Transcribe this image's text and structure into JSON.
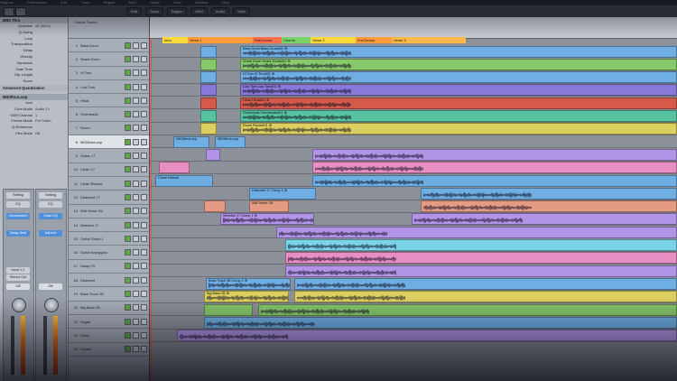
{
  "app": {
    "menu": [
      "Regions",
      "Preferences",
      "Edit",
      "Track",
      "Region",
      "MIDI",
      "Audio",
      "View",
      "Window",
      "Help"
    ],
    "toolbar_tabs": [
      "Edit",
      "Track",
      "Region",
      "MIDI",
      "Audio",
      "View"
    ]
  },
  "inspector": {
    "region_header": "MIDI Thru",
    "params": [
      {
        "label": "Quantize",
        "value": "off (3840)"
      },
      {
        "label": "Q-Swing",
        "value": ""
      },
      {
        "label": "Loop",
        "value": ""
      },
      {
        "label": "Transposition",
        "value": ""
      },
      {
        "label": "Delay",
        "value": ""
      },
      {
        "label": "Velocity",
        "value": ""
      },
      {
        "label": "Dynamics",
        "value": ""
      },
      {
        "label": "Gate Time",
        "value": ""
      },
      {
        "label": "Clip Length",
        "value": ""
      },
      {
        "label": "Score",
        "value": ""
      }
    ],
    "advanced_label": "Advanced Quantization",
    "track_header": "MIDIthruLoop",
    "track_params": [
      {
        "label": "Icon",
        "value": ""
      },
      {
        "label": "Core Audio",
        "value": "Audio 12"
      },
      {
        "label": "MIDI Channel",
        "value": "1"
      },
      {
        "label": "Freeze Mode",
        "value": "Pre Fader"
      },
      {
        "label": "Q-Reference",
        "value": ""
      },
      {
        "label": "Flex Mode",
        "value": "Off"
      }
    ],
    "strip_a": {
      "setting": "Setting",
      "eq": "EQ",
      "plugin1": "ChromaVerb",
      "plugin2": "Delay Desi",
      "io": "Input 1-2",
      "group": "Stereo Out",
      "mode": "Off"
    },
    "strip_b": {
      "setting": "Setting",
      "eq": "EQ",
      "plugin1": "Chan EQ",
      "plugin2": "AdLimit",
      "mode": "Off"
    }
  },
  "tracks_header": {
    "title": "Global Tracks"
  },
  "tracks": [
    {
      "num": "1",
      "name": "Bass Drum"
    },
    {
      "num": "2",
      "name": "Snare Drum"
    },
    {
      "num": "3",
      "name": "Hi Tom"
    },
    {
      "num": "4",
      "name": "Low Tom"
    },
    {
      "num": "5",
      "name": "Hihat"
    },
    {
      "num": "6",
      "name": "Overheads"
    },
    {
      "num": "7",
      "name": "Room"
    },
    {
      "num": "8",
      "name": "MIDIthruLoop"
    },
    {
      "num": "9",
      "name": "Guitar 17"
    },
    {
      "num": "10",
      "name": "Clean 17"
    },
    {
      "num": "11",
      "name": "Clean Reboot"
    },
    {
      "num": "12",
      "name": "Distorted 17"
    },
    {
      "num": "13",
      "name": "Wid Verse Gtr"
    },
    {
      "num": "14",
      "name": "Weeden 17"
    },
    {
      "num": "15",
      "name": "Guitar Direct 1"
    },
    {
      "num": "16",
      "name": "Guitar Arpeggios"
    },
    {
      "num": "17",
      "name": "Delay FX"
    },
    {
      "num": "18",
      "name": "Distorted"
    },
    {
      "num": "19",
      "name": "Bass Track 2B"
    },
    {
      "num": "20",
      "name": "Big Bass 2B"
    },
    {
      "num": "21",
      "name": "Organ"
    },
    {
      "num": "22",
      "name": "Piano"
    },
    {
      "num": "23",
      "name": "Vocals"
    }
  ],
  "markers": [
    {
      "label": "Intro",
      "color": "#ffd93a"
    },
    {
      "label": "Verse 1",
      "color": "#ff9b3a"
    },
    {
      "label": "PreChorus",
      "color": "#ff6f4a"
    },
    {
      "label": "Chorus",
      "color": "#7bd36b"
    },
    {
      "label": "Verse 2",
      "color": "#ffd93a"
    },
    {
      "label": "PreChorus",
      "color": "#ff9b3a"
    },
    {
      "label": "Verse 3",
      "color": "#ffb84a"
    }
  ],
  "region_labels": {
    "bass": "Bass Drum Bass Drum#01 ⊕",
    "snare": "Snare Drum Snare Drum#01 ⊕",
    "hitom": "Hi Tom Hi Tom#01 ⊕",
    "lowtom": "Low Tom Low Tom#01 ⊕",
    "hihat": "Hihat Hihat#01 ⊕",
    "overheads": "Overheads Overheads#01 ⊕",
    "room": "Room Room#01 ⊕",
    "loop": "MIDIthruLoop",
    "distorted": "Distorted 17 Comp 1 ⊕",
    "wid": "Wid Verse Gtr",
    "weeden": "Weeden 17 Comp 1 ⊕",
    "bassb": "Bass Track 2B Comp 1 ⊕",
    "bigbass": "Big Bass 2B ⊕",
    "clean": "Clean Reboot"
  },
  "colors": {
    "blue": "#6faee3",
    "green": "#86c86a",
    "purple": "#8a78d8",
    "red": "#d65a4a",
    "teal": "#58c3a0",
    "yellow": "#dccf5f",
    "lilac": "#b294e6",
    "pink": "#e88ec2",
    "salmon": "#e59a84",
    "cyan": "#7ad3e6"
  }
}
